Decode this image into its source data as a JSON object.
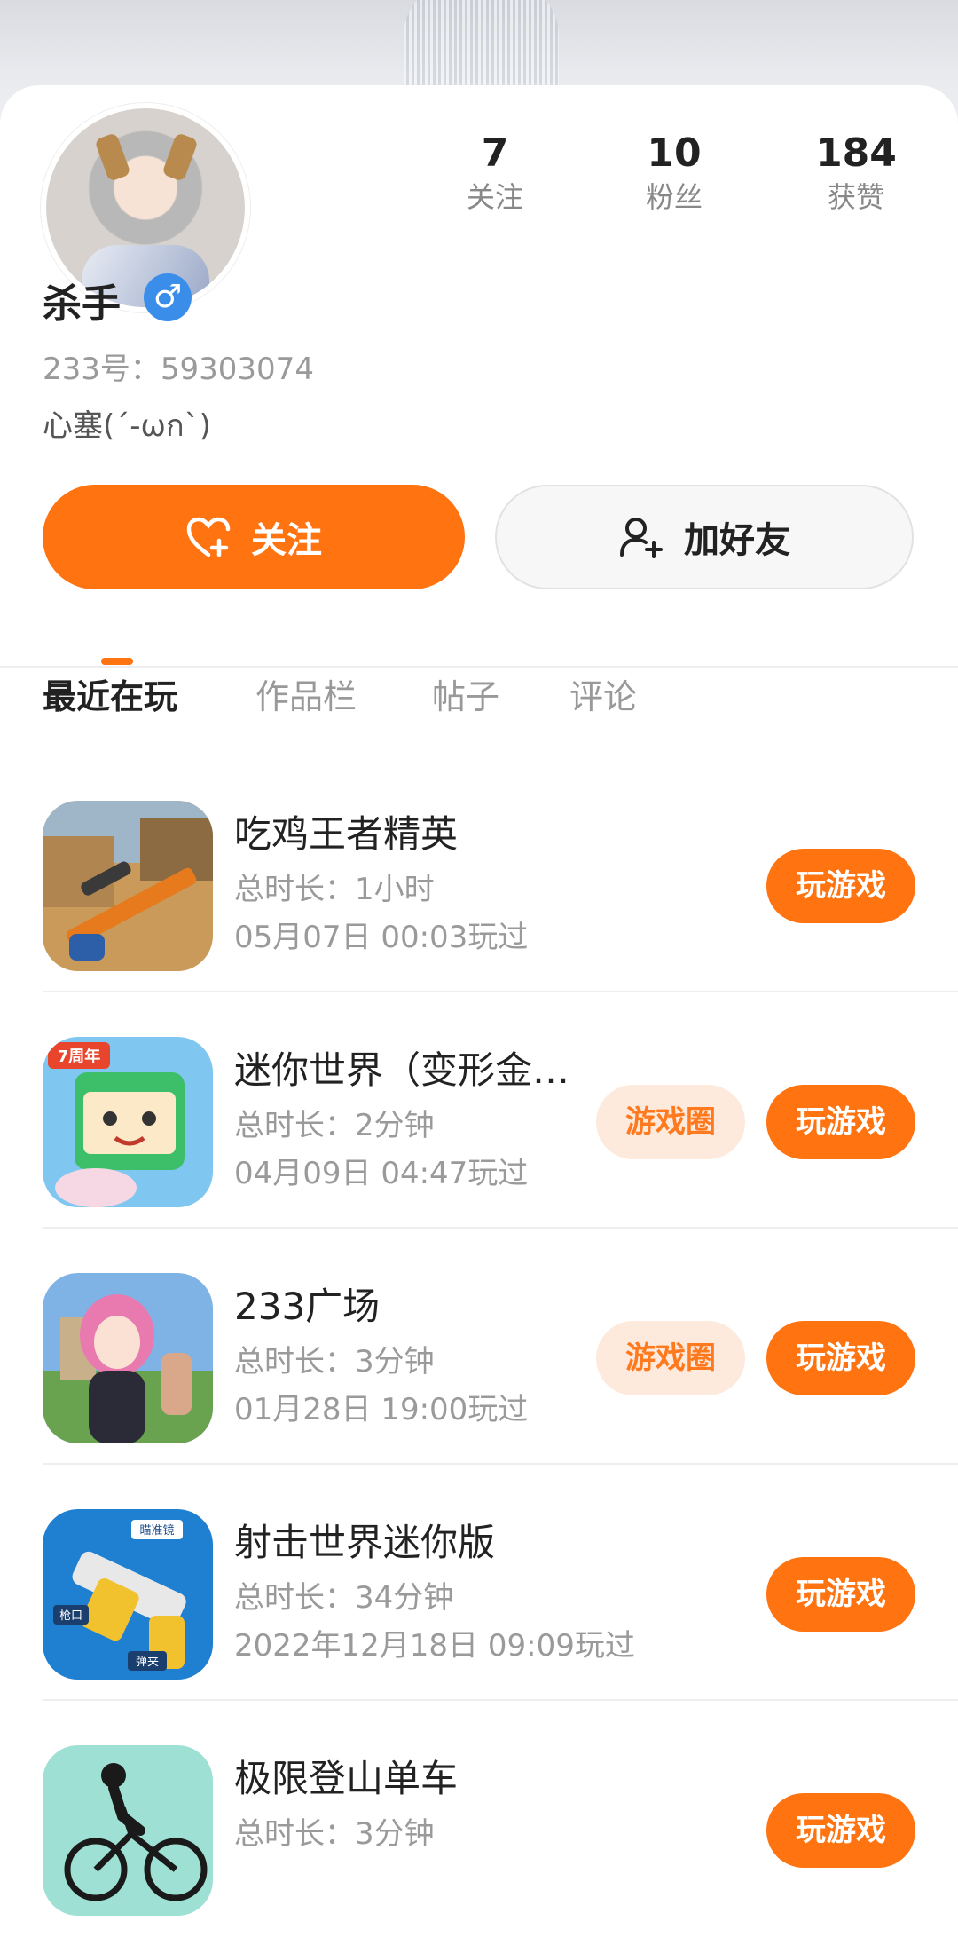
{
  "profile": {
    "name": "杀手",
    "gender_symbol": "♂",
    "uid_text": "233号：59303074",
    "signature": "心塞(´-ωก`)"
  },
  "stats": [
    {
      "value": "7",
      "label": "关注"
    },
    {
      "value": "10",
      "label": "粉丝"
    },
    {
      "value": "184",
      "label": "获赞"
    }
  ],
  "actions": {
    "follow_label": "关注",
    "add_friend_label": "加好友"
  },
  "tabs": [
    "最近在玩",
    "作品栏",
    "帖子",
    "评论"
  ],
  "active_tab": "最近在玩",
  "games": [
    {
      "title": "吃鸡王者精英",
      "duration": "总时长：1小时",
      "last_played": "05月07日 00:03玩过",
      "circle_label": "",
      "play_label": "玩游戏"
    },
    {
      "title": "迷你世界（变形金…",
      "duration": "总时长：2分钟",
      "last_played": "04月09日 04:47玩过",
      "circle_label": "游戏圈",
      "play_label": "玩游戏"
    },
    {
      "title": "233广场",
      "duration": "总时长：3分钟",
      "last_played": "01月28日 19:00玩过",
      "circle_label": "游戏圈",
      "play_label": "玩游戏"
    },
    {
      "title": "射击世界迷你版",
      "duration": "总时长：34分钟",
      "last_played": "2022年12月18日 09:09玩过",
      "circle_label": "",
      "play_label": "玩游戏"
    },
    {
      "title": "极限登山单车",
      "duration": "总时长：3分钟",
      "last_played": "",
      "circle_label": "",
      "play_label": "玩游戏"
    }
  ],
  "icon_badges": {
    "mini_world_badge": "7周年",
    "gun_labels": [
      "瞄准镜",
      "枪口",
      "弹夹"
    ]
  },
  "colors": {
    "accent": "#ff7310",
    "circle_bg": "#fdeadd",
    "gender_blue": "#3a8eea"
  }
}
